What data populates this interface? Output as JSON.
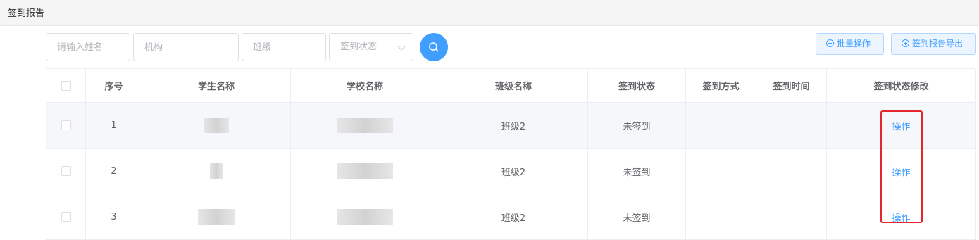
{
  "page": {
    "title": "签到报告"
  },
  "filters": {
    "name_placeholder": "请输入姓名",
    "org_placeholder": "机构",
    "class_placeholder": "班级",
    "status_placeholder": "签到状态"
  },
  "actions": {
    "batch_label": "批量操作",
    "export_label": "签到报告导出"
  },
  "table": {
    "columns": [
      "序号",
      "学生名称",
      "学校名称",
      "班级名称",
      "签到状态",
      "签到方式",
      "签到时间",
      "签到状态修改"
    ],
    "rows": [
      {
        "index": "1",
        "student": "",
        "school": "",
        "class_name": "班级2",
        "status": "未签到",
        "method": "",
        "time": "",
        "action": "操作"
      },
      {
        "index": "2",
        "student": "",
        "school": "",
        "class_name": "班级2",
        "status": "未签到",
        "method": "",
        "time": "",
        "action": "操作"
      },
      {
        "index": "3",
        "student": "",
        "school": "",
        "class_name": "班级2",
        "status": "未签到",
        "method": "",
        "time": "",
        "action": "操作"
      }
    ]
  },
  "colors": {
    "primary": "#409eff",
    "highlight": "#e5262b"
  }
}
